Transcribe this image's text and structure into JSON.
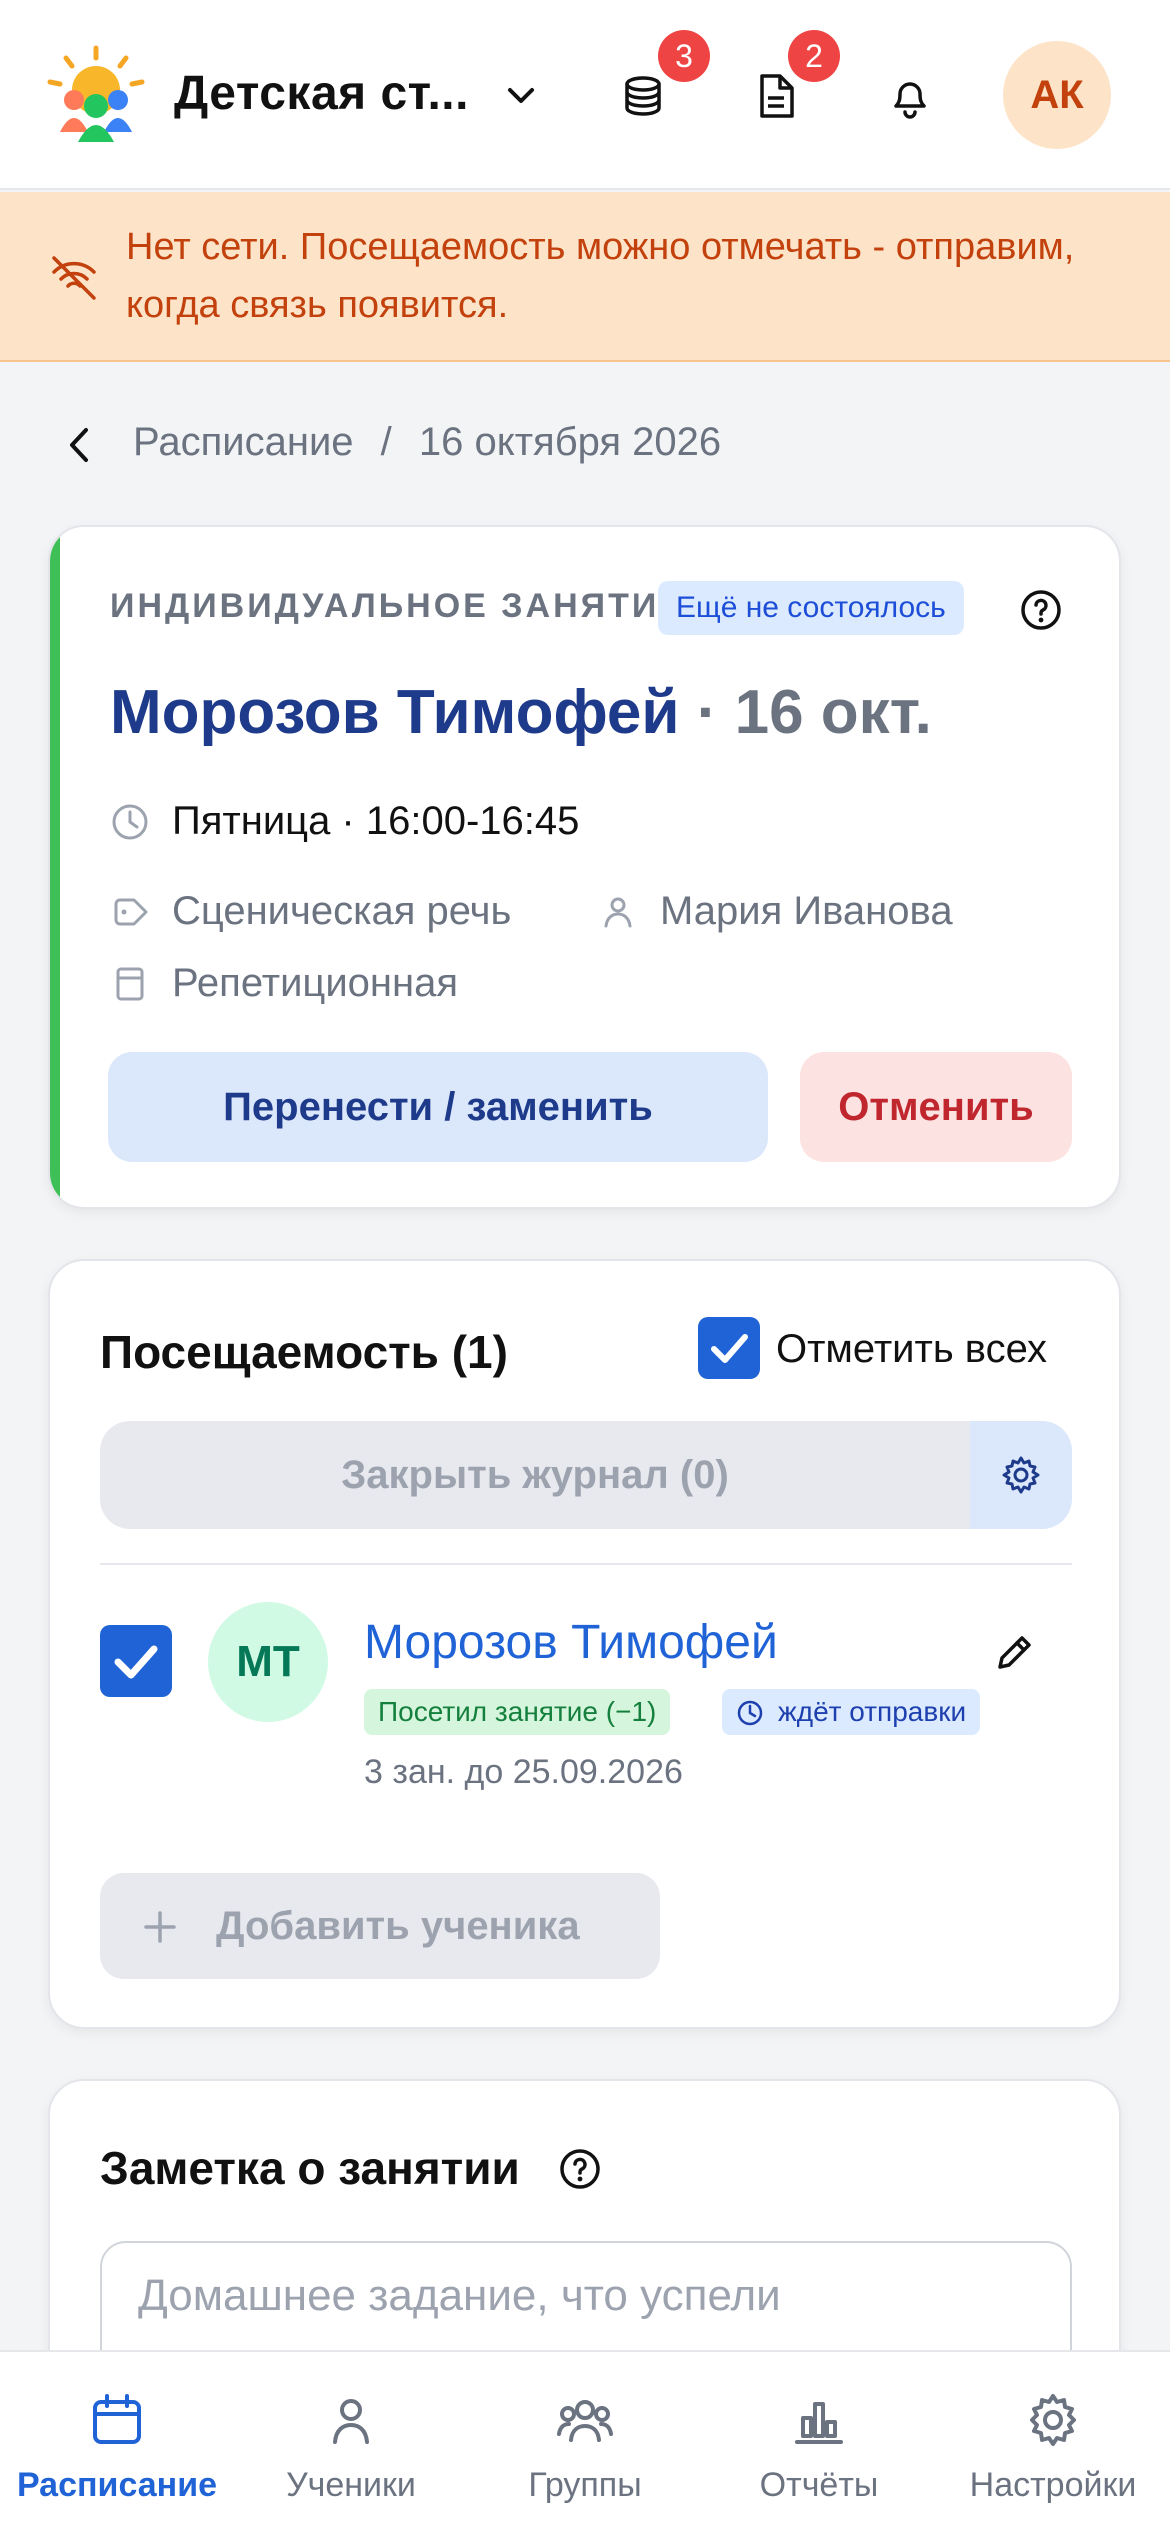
{
  "header": {
    "org_name": "Детская ст...",
    "badges": {
      "payments": "3",
      "documents": "2"
    },
    "avatar_initials": "АК"
  },
  "banner": {
    "text": "Нет сети. Посещаемость можно отмечать - отправим, когда связь появится."
  },
  "breadcrumb": {
    "parent": "Расписание",
    "separator": "/",
    "current": "16 октября 2026"
  },
  "lesson": {
    "type_label": "ИНДИВИДУАЛЬНОЕ ЗАНЯТИЕ",
    "status": "Ещё не состоялось",
    "student_name": "Морозов Тимофей",
    "date_suffix": " · 16 окт.",
    "time": "Пятница · 16:00-16:45",
    "subject": "Сценическая речь",
    "teacher": "Мария Иванова",
    "room": "Репетиционная",
    "reschedule_label": "Перенести / заменить",
    "cancel_label": "Отменить",
    "accent_color": "#3fbf57"
  },
  "attendance": {
    "title": "Посещаемость (1)",
    "mark_all_label": "Отметить всех",
    "mark_all_checked": true,
    "close_journal_label": "Закрыть журнал (0)",
    "students": [
      {
        "initials": "МТ",
        "name": "Морозов Тимофей",
        "checked": true,
        "status_tag": "Посетил занятие (−1)",
        "sync_tag": "ждёт отправки",
        "subscription": "3 зан. до 25.09.2026"
      }
    ],
    "add_student_label": "Добавить ученика"
  },
  "note": {
    "title": "Заметка о занятии",
    "placeholder": "Домашнее задание, что успели"
  },
  "bottom_nav": [
    {
      "label": "Расписание",
      "icon": "calendar-icon",
      "active": true
    },
    {
      "label": "Ученики",
      "icon": "person-icon",
      "active": false
    },
    {
      "label": "Группы",
      "icon": "group-icon",
      "active": false
    },
    {
      "label": "Отчёты",
      "icon": "chart-icon",
      "active": false
    },
    {
      "label": "Настройки",
      "icon": "gear-icon",
      "active": false
    }
  ],
  "colors": {
    "primary": "#1f63d6",
    "title_blue": "#1e3a8a",
    "warning_bg": "#fde3c8",
    "warning_text": "#c2410c",
    "danger": "#c0262d",
    "badge": "#ef4444"
  }
}
